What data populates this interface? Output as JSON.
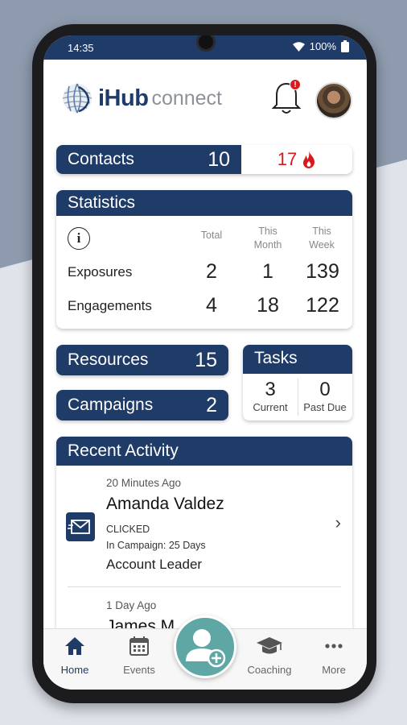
{
  "status": {
    "time": "14:35",
    "battery": "100%"
  },
  "brand": {
    "name_bold": "iHub",
    "name_light": "connect"
  },
  "notifications": {
    "badge": "!"
  },
  "contacts": {
    "label": "Contacts",
    "count": "10",
    "hot_count": "17"
  },
  "statistics": {
    "title": "Statistics",
    "columns": [
      "Total",
      "This Month",
      "This Week"
    ],
    "rows": [
      {
        "label": "Exposures",
        "values": [
          "2",
          "1",
          "139"
        ]
      },
      {
        "label": "Engagements",
        "values": [
          "4",
          "18",
          "122"
        ]
      }
    ]
  },
  "resources": {
    "label": "Resources",
    "count": "15"
  },
  "campaigns": {
    "label": "Campaigns",
    "count": "2"
  },
  "tasks": {
    "title": "Tasks",
    "current_count": "3",
    "current_label": "Current",
    "pastdue_count": "0",
    "pastdue_label": "Past Due"
  },
  "recent_activity": {
    "title": "Recent Activity",
    "items": [
      {
        "time": "20 Minutes Ago",
        "name": "Amanda Valdez",
        "action": "CLICKED",
        "campaign": "In Campaign: 25 Days",
        "role": "Account Leader"
      },
      {
        "time": "1 Day Ago",
        "name": "James M"
      }
    ]
  },
  "tabbar": {
    "home": "Home",
    "events": "Events",
    "coaching": "Coaching",
    "more": "More"
  },
  "colors": {
    "navy": "#1f3b68",
    "hot": "#d71920",
    "fab": "#5ea7a5"
  }
}
